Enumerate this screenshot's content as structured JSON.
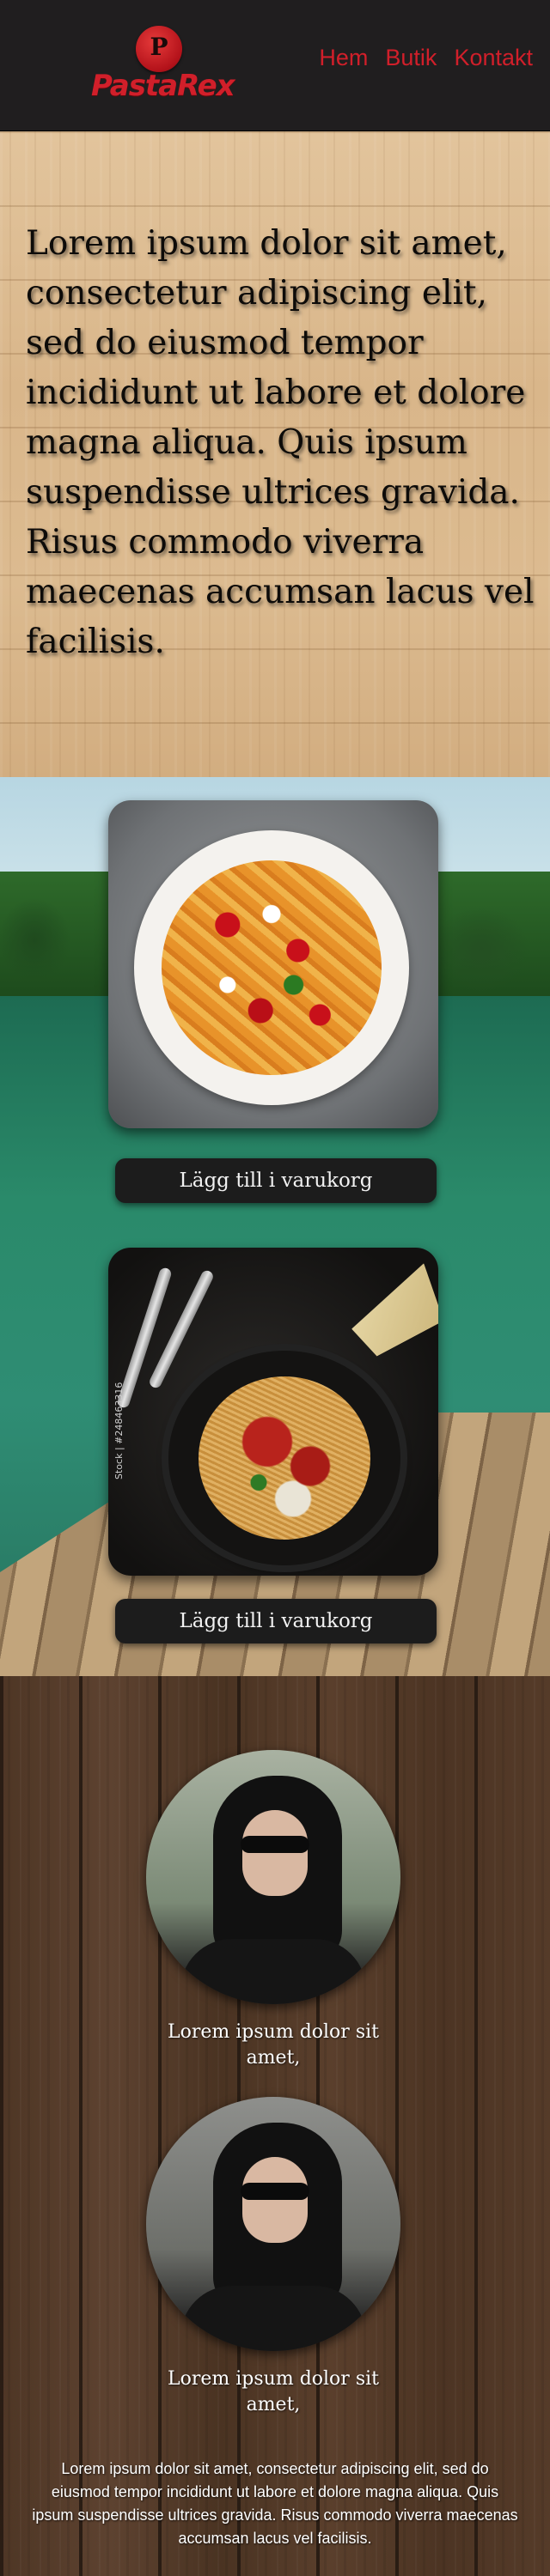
{
  "brand": {
    "emblem_letter": "P",
    "name": "PastaRex"
  },
  "nav": {
    "items": [
      "Hem",
      "Butik",
      "Kontakt"
    ]
  },
  "hero": {
    "text": "Lorem ipsum dolor sit amet, consectetur adipiscing elit, sed do eiusmod tempor incididunt ut labore et dolore magna aliqua. Quis ipsum suspendisse ultrices gravida. Risus commodo viverra maecenas accumsan lacus vel facilisis."
  },
  "products": [
    {
      "image": "penne-tomato-mozzarella-photo",
      "button_label": "Lägg till i varukorg"
    },
    {
      "image": "spaghetti-bolognese-photo",
      "watermark": "Stock | #248463316",
      "button_label": "Lägg till i varukorg"
    }
  ],
  "team": {
    "members": [
      {
        "image": "member-photo-1",
        "caption": "Lorem ipsum dolor sit amet,"
      },
      {
        "image": "member-photo-2",
        "caption": "Lorem ipsum dolor sit amet,"
      }
    ],
    "footer_text": "Lorem ipsum dolor sit amet, consectetur adipiscing elit, sed do eiusmod tempor incididunt ut labore et dolore magna aliqua. Quis ipsum suspendisse ultrices gravida. Risus commodo viverra maecenas accumsan lacus vel facilisis."
  },
  "colors": {
    "accent": "#d11f2a",
    "header_bg": "#201e1f",
    "button_bg": "#1c1c1c"
  }
}
